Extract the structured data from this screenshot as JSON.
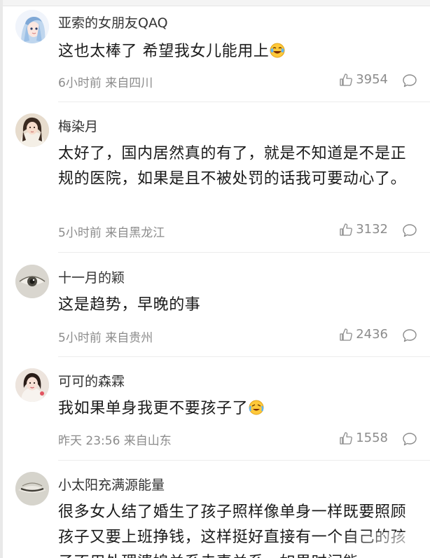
{
  "comments": [
    {
      "username": "亚索的女朋友QAQ",
      "text": "这也太棒了 希望我女儿能用上",
      "emoji": "laughing-tears-icon",
      "meta": "6小时前 来自四川",
      "likes": "3954"
    },
    {
      "username": "梅染月",
      "text": "太好了，国内居然真的有了，就是不知道是不是正规的医院，如果是且不被处罚的话我可要动心了。",
      "meta": "5小时前 来自黑龙江",
      "likes": "3132"
    },
    {
      "username": "十一月的颖",
      "text": "这是趋势，早晚的事",
      "meta": "5小时前 来自贵州",
      "likes": "2436"
    },
    {
      "username": "可可的森霖",
      "text": "我如果单身我更不要孩子了",
      "emoji": "laughing-crying-icon",
      "meta": "昨天 23:56 来自山东",
      "likes": "1558"
    },
    {
      "username": "小太阳充满源能量",
      "text": "很多女人结了婚生了孩子照样像单身一样既要照顾孩子又要上班挣钱，这样挺好直接有一个自己的孩子不用处理婆媳关系夫妻关系，如果时间能"
    }
  ],
  "colors": {
    "text": "#1a1a1a",
    "username": "#333333",
    "meta": "#8c8c8c",
    "divider": "#ececec"
  }
}
